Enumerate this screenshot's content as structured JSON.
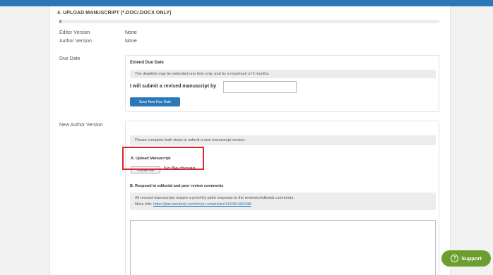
{
  "section": {
    "title": "4. UPLOAD MANUSCRIPT (*.DOC/.DOCX ONLY)"
  },
  "versions": {
    "editor_label": "Editor Version",
    "editor_value": "None",
    "author_label": "Author Version",
    "author_value": "None"
  },
  "due_date": {
    "label": "Due Date",
    "box_title": "Extend Due Date",
    "notice": "The deadline may be extended one time only, and by a maximum of 3 months.",
    "submit_label": "I will submit a revised manuscript by",
    "input_value": "",
    "save_button": "Save New Due Date"
  },
  "new_author_version": {
    "label": "New Author Version",
    "notice": "Please complete both steps to submit a new manuscript version.",
    "step_a_title": "A. Upload Manuscript",
    "choose_file_label": "Choose File",
    "no_file_text": "No file chosen",
    "step_b_title": "B. Respond to editorial and peer review comments",
    "step_b_notice_line1": "All revised manuscripts require a point-by-point response to the reviewer/editorial comments.",
    "step_b_more_info": "More info:",
    "step_b_link": "https://jmir.zendesk.com/hc/en-us/articles/115001400448",
    "response_value": ""
  },
  "support": {
    "label": "Support",
    "icon": "question-circle-icon"
  },
  "colors": {
    "brand_blue": "#2a78b8",
    "highlight_red": "#e0252a",
    "support_green": "#6a9e2e"
  }
}
